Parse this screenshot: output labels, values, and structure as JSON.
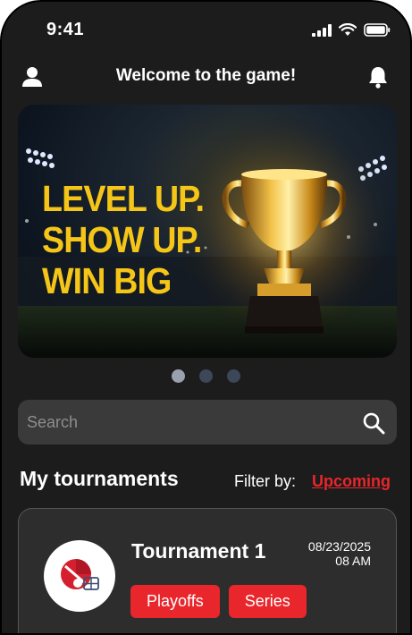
{
  "status_bar": {
    "time": "9:41"
  },
  "header": {
    "title": "Welcome to the game!"
  },
  "banner": {
    "lines": [
      "LEVEL UP.",
      "SHOW UP.",
      "WIN BIG"
    ]
  },
  "carousel": {
    "total": 3,
    "active_index": 0
  },
  "search": {
    "placeholder": "Search",
    "value": ""
  },
  "tournaments": {
    "title": "My tournaments",
    "filter_label": "Filter by:",
    "filter_value": "Upcoming",
    "items": [
      {
        "name": "Tournament 1",
        "date": "08/23/2025",
        "time": "08 AM",
        "tags": [
          "Playoffs",
          "Series"
        ]
      }
    ]
  },
  "colors": {
    "accent": "#e8262b",
    "background": "#1c1c1c",
    "banner_text": "#f5c518"
  }
}
